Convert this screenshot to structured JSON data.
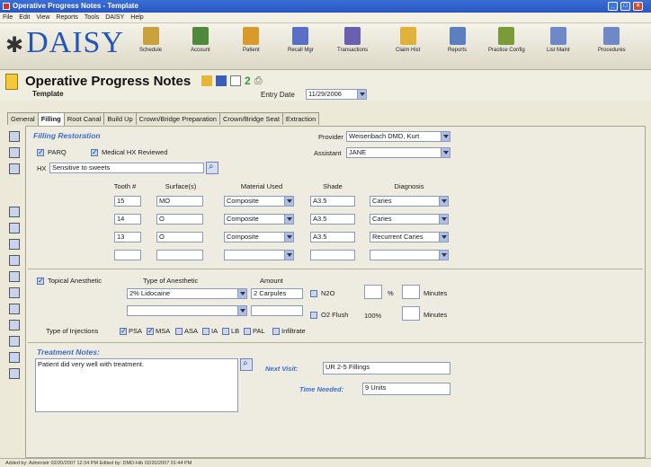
{
  "window": {
    "title": "Operative Progress Notes - Template"
  },
  "menu": [
    "File",
    "Edit",
    "View",
    "Reports",
    "Tools",
    "DAISY",
    "Help"
  ],
  "logo": {
    "text": "DAISY"
  },
  "toolbar": [
    {
      "label": "Schedule",
      "icon": "calendar-icon",
      "color": "#c9a23c"
    },
    {
      "label": "Account",
      "icon": "account-icon",
      "color": "#4f8a3c"
    },
    {
      "label": "Patient",
      "icon": "patient-icon",
      "color": "#d89a2a"
    },
    {
      "label": "Recall Mgr",
      "icon": "recall-icon",
      "color": "#5a6fc8"
    },
    {
      "label": "Transactions",
      "icon": "transactions-icon",
      "color": "#6a5fb0"
    },
    {
      "label": "Claim Hist",
      "icon": "claim-icon",
      "color": "#e0b23a"
    },
    {
      "label": "Reports",
      "icon": "reports-icon",
      "color": "#5d7fc0"
    },
    {
      "label": "Practice Config",
      "icon": "config-icon",
      "color": "#7b9a3a"
    },
    {
      "label": "List Maint",
      "icon": "list-icon",
      "color": "#6f88c8"
    },
    {
      "label": "Procedures",
      "icon": "procedures-icon",
      "color": "#6f88c8"
    }
  ],
  "page": {
    "title": "Operative Progress Notes",
    "template_label": "Template",
    "entry_date_label": "Entry Date",
    "entry_date": "11/29/2006"
  },
  "tabs": [
    "General",
    "Filling",
    "Root Canal",
    "Build Up",
    "Crown/Bridge Preparation",
    "Crown/Bridge Seat",
    "Extraction"
  ],
  "filling": {
    "section_title": "Filling Restoration",
    "paro_label": "PARQ",
    "medical_hx_label": "Medical HX Reviewed",
    "hx_label": "HX",
    "hx_value": "Sensitive to sweets",
    "provider_label": "Provider",
    "provider_value": "Weisenbach DMD, Kurt",
    "assistant_label": "Assistant",
    "assistant_value": "JANE",
    "columns": [
      "Tooth #",
      "Surface(s)",
      "Material Used",
      "Shade",
      "Diagnosis"
    ],
    "rows": [
      {
        "tooth": "15",
        "surface": "MO",
        "material": "Composite",
        "shade": "A3.5",
        "diagnosis": "Caries"
      },
      {
        "tooth": "14",
        "surface": "O",
        "material": "Composite",
        "shade": "A3.5",
        "diagnosis": "Caries"
      },
      {
        "tooth": "13",
        "surface": "O",
        "material": "Composite",
        "shade": "A3.5",
        "diagnosis": "Recurrent Caries"
      },
      {
        "tooth": "",
        "surface": "",
        "material": "",
        "shade": "",
        "diagnosis": ""
      }
    ]
  },
  "anesthesia": {
    "topical_label": "Topical Anesthetic",
    "type_label": "Type of Anesthetic",
    "amount_label": "Amount",
    "type_value": "2% Lidocaine",
    "amount_value": "2 Carpules",
    "n2o_label": "N2O",
    "percent_label": "%",
    "minutes_label": "Minutes",
    "o2_label": "O2 Flush",
    "o2_value": "100%",
    "injections_label": "Type of Injections",
    "injections": [
      {
        "label": "PSA",
        "checked": true
      },
      {
        "label": "MSA",
        "checked": true
      },
      {
        "label": "ASA",
        "checked": false
      },
      {
        "label": "IA",
        "checked": false
      },
      {
        "label": "LB",
        "checked": false
      },
      {
        "label": "PAL",
        "checked": false
      },
      {
        "label": "Infiltrate",
        "checked": false
      }
    ]
  },
  "notes": {
    "title": "Treatment Notes:",
    "text": "Patient did very well with treatment.",
    "next_visit_label": "Next Visit:",
    "next_visit_value": "UR 2-5 Fillings",
    "time_needed_label": "Time Needed:",
    "time_needed_value": "9 Units"
  },
  "status": {
    "text": "Added by: Administr 02/20/2007 12:34 PM   Edited by: DMD-Hib 02/20/2007 01:44 PM"
  }
}
